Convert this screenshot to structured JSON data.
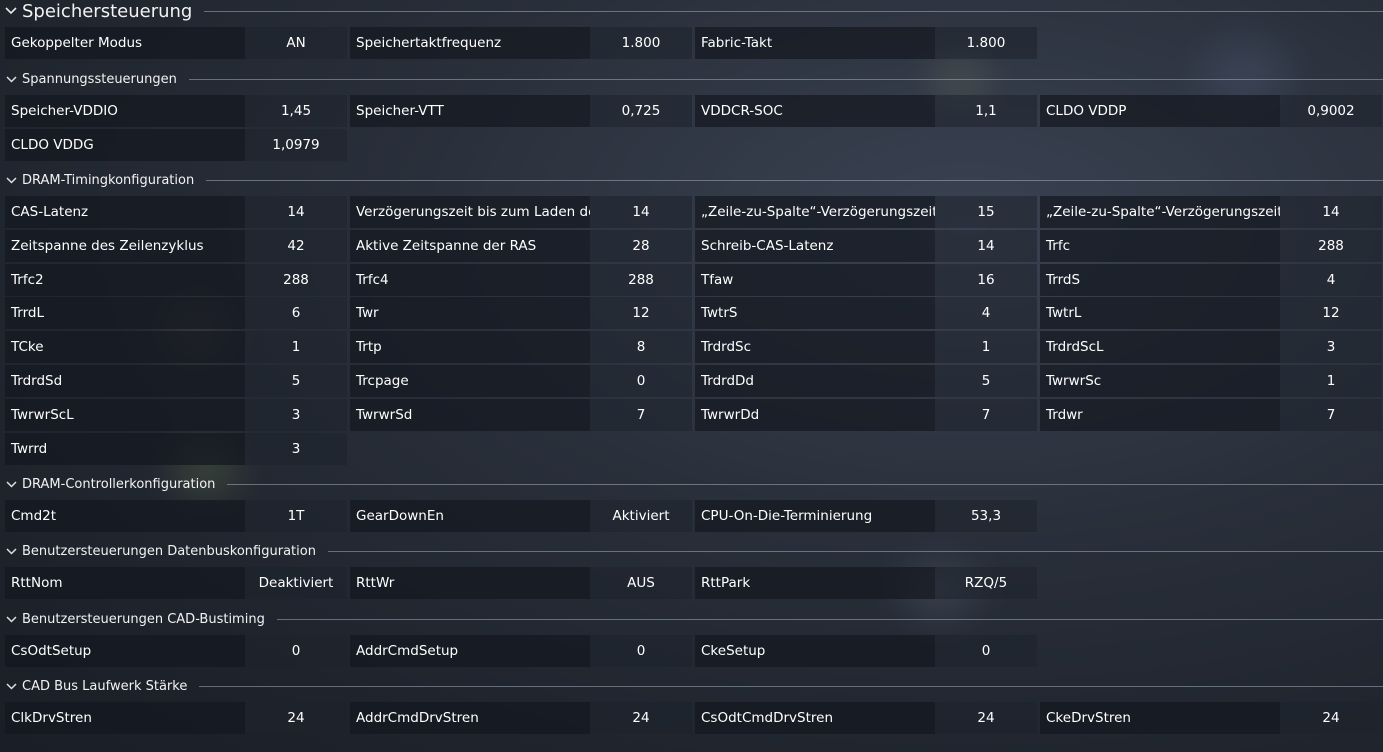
{
  "header": {
    "title": "Speichersteuerung"
  },
  "sections": [
    {
      "title": "",
      "rows": [
        [
          {
            "label": "Gekoppelter Modus",
            "value": "AN"
          },
          {
            "label": "Speichertaktfrequenz",
            "value": "1.800"
          },
          {
            "label": "Fabric-Takt",
            "value": "1.800"
          }
        ]
      ]
    },
    {
      "title": "Spannungssteuerungen",
      "rows": [
        [
          {
            "label": "Speicher-VDDIO",
            "value": "1,45"
          },
          {
            "label": "Speicher-VTT",
            "value": "0,725"
          },
          {
            "label": "VDDCR-SOC",
            "value": "1,1"
          },
          {
            "label": "CLDO VDDP",
            "value": "0,9002"
          }
        ],
        [
          {
            "label": "CLDO VDDG",
            "value": "1,0979"
          }
        ]
      ]
    },
    {
      "title": "DRAM-Timingkonfiguration",
      "rows": [
        [
          {
            "label": "CAS-Latenz",
            "value": "14"
          },
          {
            "label": "Verzögerungszeit bis zum Laden der…",
            "value": "14"
          },
          {
            "label": "„Zeile-zu-Spalte“-Verzögerungszeit …",
            "value": "15"
          },
          {
            "label": "„Zeile-zu-Spalte“-Verzögerungszeit …",
            "value": "14"
          }
        ],
        [
          {
            "label": "Zeitspanne des Zeilenzyklus",
            "value": "42"
          },
          {
            "label": "Aktive Zeitspanne der RAS",
            "value": "28"
          },
          {
            "label": "Schreib-CAS-Latenz",
            "value": "14"
          },
          {
            "label": "Trfc",
            "value": "288"
          }
        ],
        [
          {
            "label": "Trfc2",
            "value": "288"
          },
          {
            "label": "Trfc4",
            "value": "288"
          },
          {
            "label": "Tfaw",
            "value": "16"
          },
          {
            "label": "TrrdS",
            "value": "4"
          }
        ],
        [
          {
            "label": "TrrdL",
            "value": "6"
          },
          {
            "label": "Twr",
            "value": "12"
          },
          {
            "label": "TwtrS",
            "value": "4"
          },
          {
            "label": "TwtrL",
            "value": "12"
          }
        ],
        [
          {
            "label": "TCke",
            "value": "1"
          },
          {
            "label": "Trtp",
            "value": "8"
          },
          {
            "label": "TrdrdSc",
            "value": "1"
          },
          {
            "label": "TrdrdScL",
            "value": "3"
          }
        ],
        [
          {
            "label": "TrdrdSd",
            "value": "5"
          },
          {
            "label": "Trcpage",
            "value": "0"
          },
          {
            "label": "TrdrdDd",
            "value": "5"
          },
          {
            "label": "TwrwrSc",
            "value": "1"
          }
        ],
        [
          {
            "label": "TwrwrScL",
            "value": "3"
          },
          {
            "label": "TwrwrSd",
            "value": "7"
          },
          {
            "label": "TwrwrDd",
            "value": "7"
          },
          {
            "label": "Trdwr",
            "value": "7"
          }
        ],
        [
          {
            "label": "Twrrd",
            "value": "3"
          }
        ]
      ]
    },
    {
      "title": "DRAM-Controllerkonfiguration",
      "rows": [
        [
          {
            "label": "Cmd2t",
            "value": "1T"
          },
          {
            "label": "GearDownEn",
            "value": "Aktiviert"
          },
          {
            "label": "CPU-On-Die-Terminierung",
            "value": "53,3"
          }
        ]
      ]
    },
    {
      "title": "Benutzersteuerungen Datenbuskonfiguration",
      "rows": [
        [
          {
            "label": "RttNom",
            "value": "Deaktiviert"
          },
          {
            "label": "RttWr",
            "value": "AUS"
          },
          {
            "label": "RttPark",
            "value": "RZQ/5"
          }
        ]
      ]
    },
    {
      "title": "Benutzersteuerungen CAD-Bustiming",
      "rows": [
        [
          {
            "label": "CsOdtSetup",
            "value": "0"
          },
          {
            "label": "AddrCmdSetup",
            "value": "0"
          },
          {
            "label": "CkeSetup",
            "value": "0"
          }
        ]
      ]
    },
    {
      "title": "CAD Bus Laufwerk Stärke",
      "rows": [
        [
          {
            "label": "ClkDrvStren",
            "value": "24"
          },
          {
            "label": "AddrCmdDrvStren",
            "value": "24"
          },
          {
            "label": "CsOdtCmdDrvStren",
            "value": "24"
          },
          {
            "label": "CkeDrvStren",
            "value": "24"
          }
        ]
      ]
    }
  ]
}
